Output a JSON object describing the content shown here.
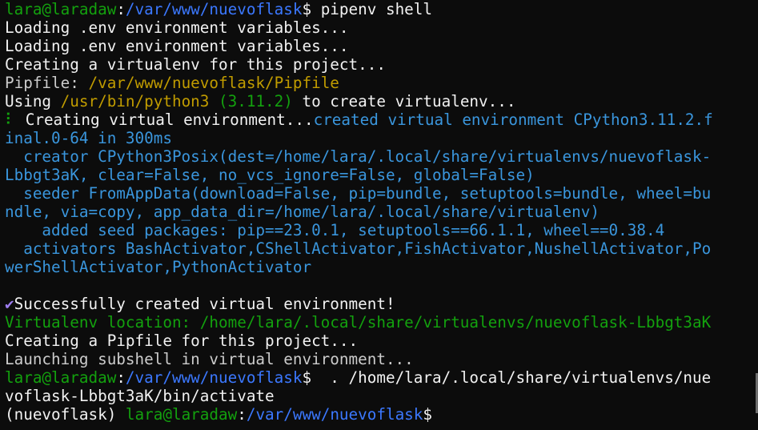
{
  "terminal": {
    "lines": [
      [
        {
          "t": "lara@laradaw",
          "c": "gr"
        },
        {
          "t": ":",
          "c": "w"
        },
        {
          "t": "/var/www/nuevoflask",
          "c": "bl"
        },
        {
          "t": "$ pipenv shell",
          "c": "w"
        }
      ],
      [
        {
          "t": "Loading .env environment variables...",
          "c": "w"
        }
      ],
      [
        {
          "t": "Loading .env environment variables...",
          "c": "w"
        }
      ],
      [
        {
          "t": "Creating a virtualenv for this project...",
          "c": "w"
        }
      ],
      [
        {
          "t": "Pipfile: ",
          "c": "g"
        },
        {
          "t": "/var/www/nuevoflask/Pipfile",
          "c": "y"
        }
      ],
      [
        {
          "t": "Using ",
          "c": "w"
        },
        {
          "t": "/usr/bin/python3",
          "c": "y"
        },
        {
          "t": " (3.11.2)",
          "c": "gr"
        },
        {
          "t": " to create virtualenv...",
          "c": "w"
        }
      ],
      [
        {
          "t": "⠇",
          "c": "gr"
        },
        {
          "t": " Creating virtual environment...",
          "c": "w"
        },
        {
          "t": "created virtual environment CPython3.11.2.f",
          "c": "db"
        }
      ],
      [
        {
          "t": "inal.0-64 in 300ms",
          "c": "db"
        }
      ],
      [
        {
          "t": "  creator CPython3Posix(dest=/home/lara/.local/share/virtualenvs/nuevoflask-",
          "c": "db"
        }
      ],
      [
        {
          "t": "Lbbgt3aK, clear=False, no_vcs_ignore=False, global=False)",
          "c": "db"
        }
      ],
      [
        {
          "t": "  seeder FromAppData(download=False, pip=bundle, setuptools=bundle, wheel=bu",
          "c": "db"
        }
      ],
      [
        {
          "t": "ndle, via=copy, app_data_dir=/home/lara/.local/share/virtualenv)",
          "c": "db"
        }
      ],
      [
        {
          "t": "    added seed packages: pip==23.0.1, setuptools==66.1.1, wheel==0.38.4",
          "c": "db"
        }
      ],
      [
        {
          "t": "  activators BashActivator,CShellActivator,FishActivator,NushellActivator,Po",
          "c": "db"
        }
      ],
      [
        {
          "t": "werShellActivator,PythonActivator",
          "c": "db"
        }
      ],
      [
        {
          "t": "",
          "c": "w"
        }
      ],
      [
        {
          "t": "✔",
          "c": "mk"
        },
        {
          "t": "Successfully created virtual environment!",
          "c": "w"
        }
      ],
      [
        {
          "t": "Virtualenv location: /home/lara/.local/share/virtualenvs/nuevoflask-Lbbgt3aK",
          "c": "gr"
        }
      ],
      [
        {
          "t": "Creating a Pipfile for this project...",
          "c": "w"
        }
      ],
      [
        {
          "t": "Launching subshell in virtual environment...",
          "c": "g"
        }
      ],
      [
        {
          "t": "lara@laradaw",
          "c": "gr"
        },
        {
          "t": ":",
          "c": "w"
        },
        {
          "t": "/var/www/nuevoflask",
          "c": "bl"
        },
        {
          "t": "$  . /home/lara/.local/share/virtualenvs/nue",
          "c": "w"
        }
      ],
      [
        {
          "t": "voflask-Lbbgt3aK/bin/activate",
          "c": "w"
        }
      ],
      [
        {
          "t": "(nuevoflask) ",
          "c": "w"
        },
        {
          "t": "lara@laradaw",
          "c": "gr"
        },
        {
          "t": ":",
          "c": "w"
        },
        {
          "t": "/var/www/nuevoflask",
          "c": "bl"
        },
        {
          "t": "$",
          "c": "w"
        }
      ]
    ]
  }
}
